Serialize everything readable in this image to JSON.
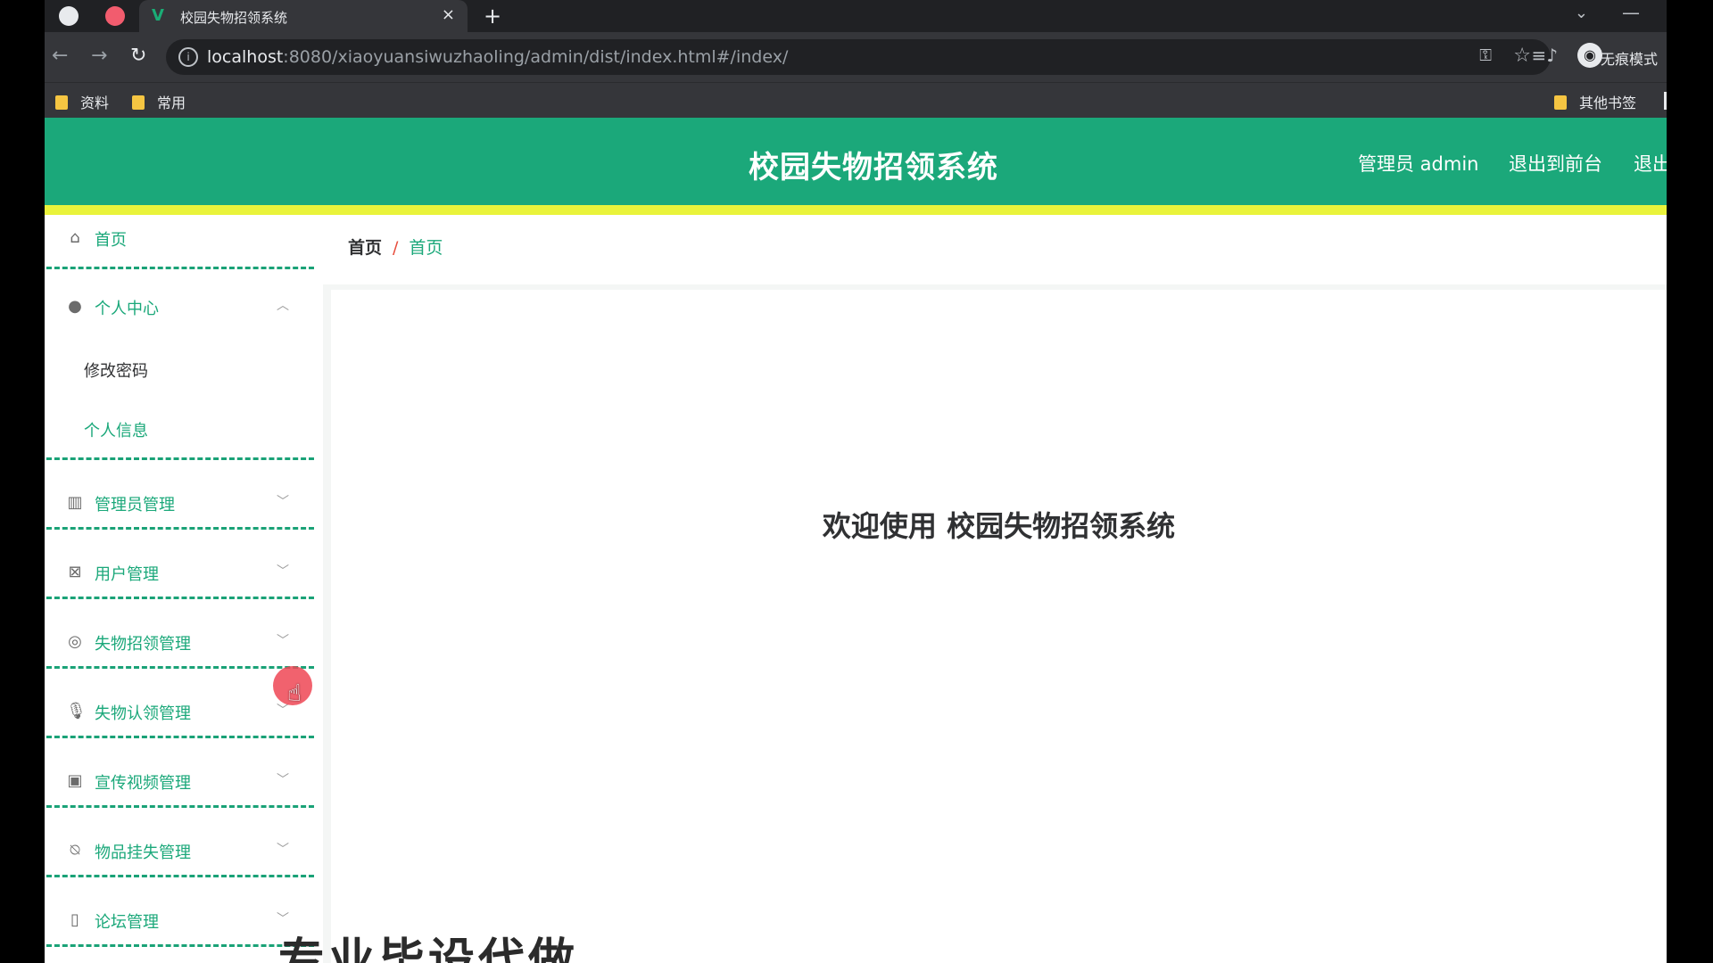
{
  "browser": {
    "tab_title": "校园失物招领系统",
    "tab_favicon": "V",
    "tab_close": "×",
    "new_tab": "+",
    "url_host": "localhost",
    "url_rest": ":8080/xiaoyuansiwuzhaoling/admin/dist/index.html#/index/",
    "incognito_label": "无痕模式",
    "bookmarks": [
      "资料",
      "常用"
    ],
    "other_bookmarks": "其他书签",
    "icons": {
      "tab1": "globe-icon",
      "tab2": "app-icon",
      "back": "arrow-left-icon",
      "forward": "arrow-right-icon",
      "reload": "reload-icon",
      "info": "info-icon",
      "key": "key-icon",
      "star": "star-icon",
      "media": "media-control-icon",
      "incognito": "incognito-icon",
      "chevron": "chevron-down-icon",
      "minimize": "minimize-icon"
    }
  },
  "header": {
    "title": "校园失物招领系统",
    "user": "管理员 admin",
    "to_front": "退出到前台",
    "logout": "退出"
  },
  "sidebar": {
    "items": [
      {
        "label": "首页",
        "icon": "home-icon"
      },
      {
        "label": "个人中心",
        "icon": "user-icon",
        "expanded": true,
        "children": [
          {
            "label": "修改密码"
          },
          {
            "label": "个人信息"
          }
        ]
      },
      {
        "label": "管理员管理",
        "icon": "books-icon"
      },
      {
        "label": "用户管理",
        "icon": "delete-box-icon"
      },
      {
        "label": "失物招领管理",
        "icon": "target-icon"
      },
      {
        "label": "失物认领管理",
        "icon": "microphone-icon"
      },
      {
        "label": "宣传视频管理",
        "icon": "clipboard-icon"
      },
      {
        "label": "物品挂失管理",
        "icon": "bell-off-icon"
      },
      {
        "label": "论坛管理",
        "icon": "battery-icon"
      }
    ]
  },
  "breadcrumb": {
    "home": "首页",
    "separator": "/",
    "current": "首页"
  },
  "main": {
    "welcome": "欢迎使用 校园失物招领系统"
  },
  "overlay": {
    "text": "专业毕设代做"
  },
  "colors": {
    "header_green": "#1ba87a",
    "accent_yellow": "#e9f33b",
    "link_green": "#1ba87a",
    "breadcrumb_sep": "#e74c3c",
    "cursor_highlight": "#ee4655"
  }
}
